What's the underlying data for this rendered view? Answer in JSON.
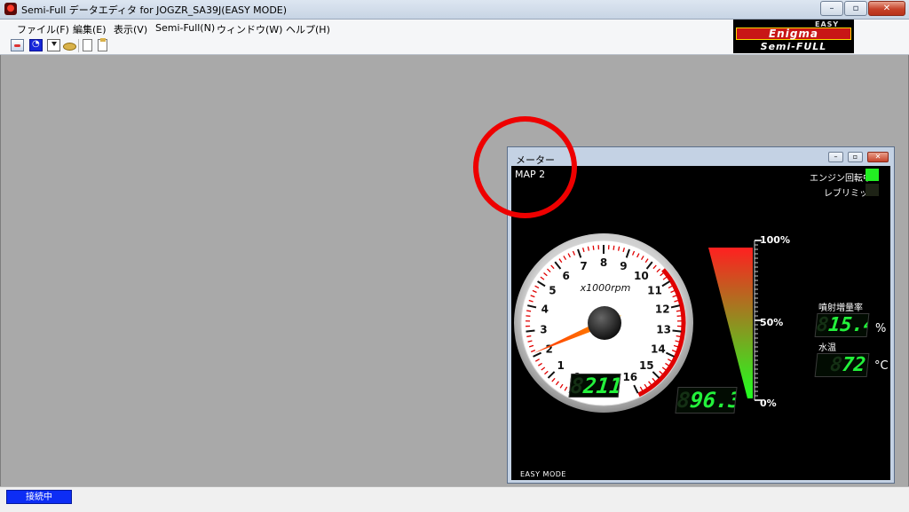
{
  "window": {
    "title": "Semi-Full データエディタ for JOGZR_SA39J(EASY MODE)",
    "minimize": "–",
    "maximize": "▫",
    "close": "✕"
  },
  "menu": [
    {
      "label": "ファイル(F)"
    },
    {
      "label": "編集(E)"
    },
    {
      "label": "表示(V)"
    },
    {
      "label": "Semi-Full(N)"
    },
    {
      "label": "ウィンドウ(W)"
    },
    {
      "label": "ヘルプ(H)"
    }
  ],
  "logo": {
    "top": "EASY",
    "middle": "Enigma",
    "bottom": "Semi-FULL"
  },
  "toolbar_icons": [
    "meter-icon",
    "blue-app-icon",
    "download-icon",
    "disk-icon",
    "new-doc-icon",
    "open-doc-icon"
  ],
  "meter_window": {
    "title": "メーター",
    "map_label": "MAP 2",
    "engine_running": {
      "label": "エンジン回転中",
      "active": true,
      "color": "#22ee22"
    },
    "rev_limit": {
      "label": "レブリミット",
      "active": false,
      "color": "#1e2316"
    },
    "tach": {
      "unit": "x1000rpm",
      "ticks": [
        "0",
        "1",
        "2",
        "3",
        "4",
        "5",
        "6",
        "7",
        "8",
        "9",
        "10",
        "11",
        "12",
        "13",
        "14",
        "15",
        "16"
      ],
      "rpm": 2110,
      "rpm_display": "2110",
      "rpm_ghost": "8"
    },
    "throttle": {
      "display": "96.3",
      "ghost": "8",
      "scale": [
        "100%",
        "50%",
        "0%"
      ]
    },
    "injection": {
      "label": "噴射増量率",
      "value": "15.4",
      "ghost": "8",
      "unit": "%"
    },
    "water_temp": {
      "label": "水温",
      "value": "72",
      "ghost": "8",
      "unit": "°C"
    },
    "mode": "EASY MODE"
  },
  "status": {
    "connection": "接続中"
  },
  "colors": {
    "accent_red": "#ee0000",
    "lcd_green": "#23f23b",
    "status_blue": "#0d2df5"
  }
}
